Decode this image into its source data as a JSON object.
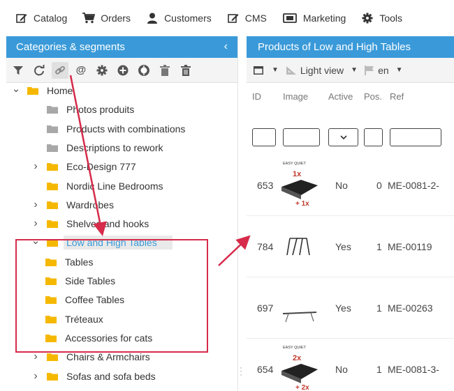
{
  "topbar": {
    "items": [
      {
        "label": "Catalog",
        "icon": "edit-icon"
      },
      {
        "label": "Orders",
        "icon": "cart-icon"
      },
      {
        "label": "Customers",
        "icon": "user-icon"
      },
      {
        "label": "CMS",
        "icon": "edit-icon"
      },
      {
        "label": "Marketing",
        "icon": "ticket-icon"
      },
      {
        "label": "Tools",
        "icon": "gear-icon"
      }
    ]
  },
  "left_panel": {
    "title": "Categories & segments",
    "collapse": "‹",
    "tree": [
      {
        "label": "Home",
        "level": 0,
        "expander": "expanded",
        "folder": "yellow"
      },
      {
        "label": "Photos produits",
        "level": 1,
        "expander": "none",
        "folder": "gray"
      },
      {
        "label": "Products with combinations",
        "level": 1,
        "expander": "none",
        "folder": "gray"
      },
      {
        "label": "Descriptions to rework",
        "level": 1,
        "expander": "none",
        "folder": "gray"
      },
      {
        "label": "Eco-Design 777",
        "level": 1,
        "expander": "collapsed",
        "folder": "yellow"
      },
      {
        "label": "Nordic Line Bedrooms",
        "level": 1,
        "expander": "none",
        "folder": "yellow"
      },
      {
        "label": "Wardrobes",
        "level": 1,
        "expander": "collapsed",
        "folder": "yellow"
      },
      {
        "label": "Shelves and hooks",
        "level": 1,
        "expander": "collapsed",
        "folder": "yellow"
      },
      {
        "label": "Low and High Tables",
        "level": 1,
        "expander": "expanded",
        "folder": "yellow",
        "selected": true
      },
      {
        "label": "Tables",
        "level": 2,
        "expander": "none",
        "folder": "yellow"
      },
      {
        "label": "Side Tables",
        "level": 2,
        "expander": "none",
        "folder": "yellow"
      },
      {
        "label": "Coffee Tables",
        "level": 2,
        "expander": "none",
        "folder": "yellow"
      },
      {
        "label": "Tréteaux",
        "level": 2,
        "expander": "none",
        "folder": "yellow"
      },
      {
        "label": "Accessories for cats",
        "level": 2,
        "expander": "none",
        "folder": "yellow"
      },
      {
        "label": "Chairs & Armchairs",
        "level": 1,
        "expander": "collapsed",
        "folder": "yellow"
      },
      {
        "label": "Sofas and sofa beds",
        "level": 1,
        "expander": "collapsed",
        "folder": "yellow"
      }
    ]
  },
  "right_panel": {
    "title": "Products of Low and High Tables",
    "toolbar": {
      "view_label": "Light view",
      "lang_label": "en"
    },
    "columns": [
      "ID",
      "Image",
      "Active",
      "Pos.",
      "Ref"
    ],
    "rows": [
      {
        "id": "653",
        "active": "No",
        "pos": "0",
        "ref": "ME-0081-2-",
        "image": "easy-quiet-1x",
        "image_text": [
          "EASY QUIET",
          "1x",
          "+ 1x"
        ]
      },
      {
        "id": "784",
        "active": "Yes",
        "pos": "1",
        "ref": "ME-00119",
        "image": "trestle-legs",
        "image_text": []
      },
      {
        "id": "697",
        "active": "Yes",
        "pos": "1",
        "ref": "ME-00263",
        "image": "table-top",
        "image_text": []
      },
      {
        "id": "654",
        "active": "No",
        "pos": "1",
        "ref": "ME-0081-3-",
        "image": "easy-quiet-2x",
        "image_text": [
          "EASY QUIET",
          "2x",
          "+ 2x"
        ]
      }
    ]
  },
  "colors": {
    "accent": "#3a9ad9",
    "folder_yellow": "#f5b800",
    "folder_gray": "#a8a8a8",
    "annotation_red": "#d62b4a"
  }
}
